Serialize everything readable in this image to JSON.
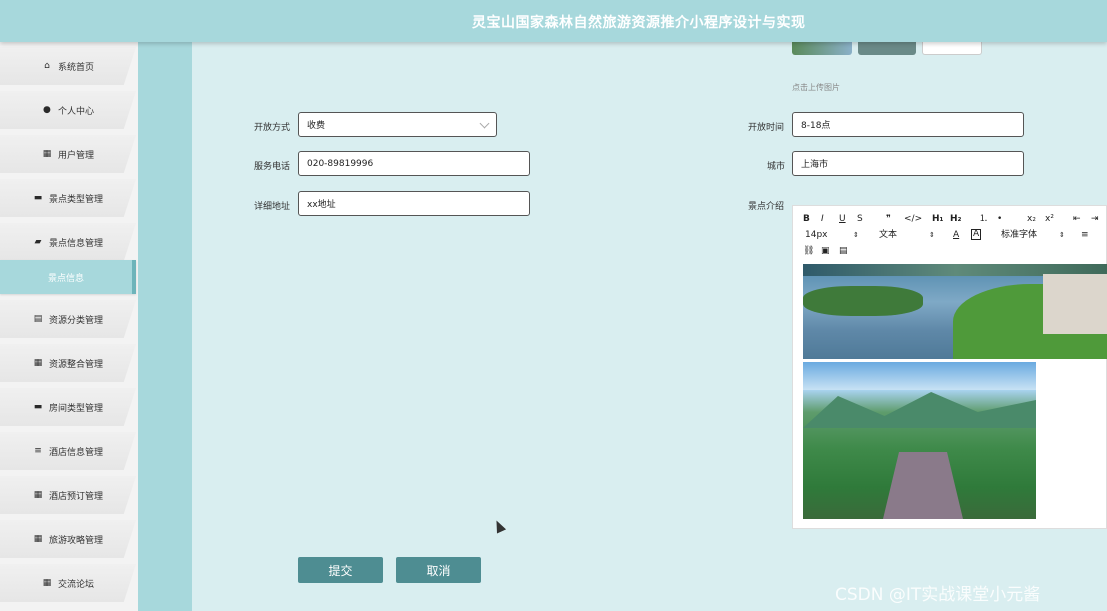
{
  "header": {
    "title": "灵宝山国家森林自然旅游资源推介小程序设计与实现"
  },
  "sidebar": {
    "items": [
      {
        "label": "系统首页",
        "icon": "home-icon",
        "glyph": "⌂",
        "active": false
      },
      {
        "label": "个人中心",
        "icon": "user-icon",
        "glyph": "●",
        "active": false
      },
      {
        "label": "用户管理",
        "icon": "grid-icon",
        "glyph": "▦",
        "active": false
      },
      {
        "label": "景点类型管理",
        "icon": "monitor-icon",
        "glyph": "▬",
        "active": false
      },
      {
        "label": "景点信息管理",
        "icon": "briefcase-icon",
        "glyph": "▰",
        "active": false
      },
      {
        "label": "景点信息",
        "icon": "",
        "glyph": "",
        "active": true
      },
      {
        "label": "资源分类管理",
        "icon": "clipboard-icon",
        "glyph": "▤",
        "active": false
      },
      {
        "label": "资源整合管理",
        "icon": "grid-icon",
        "glyph": "▦",
        "active": false
      },
      {
        "label": "房间类型管理",
        "icon": "monitor-icon",
        "glyph": "▬",
        "active": false
      },
      {
        "label": "酒店信息管理",
        "icon": "list-icon",
        "glyph": "≡",
        "active": false
      },
      {
        "label": "酒店预订管理",
        "icon": "grid-icon",
        "glyph": "▦",
        "active": false
      },
      {
        "label": "旅游攻略管理",
        "icon": "grid-icon",
        "glyph": "▦",
        "active": false
      },
      {
        "label": "交流论坛",
        "icon": "grid-icon",
        "glyph": "▦",
        "active": false
      }
    ]
  },
  "form": {
    "upload_hint": "点击上传图片",
    "open_mode": {
      "label": "开放方式",
      "value": "收费"
    },
    "open_time": {
      "label": "开放时间",
      "value": "8-18点"
    },
    "phone": {
      "label": "服务电话",
      "value": "020-89819996"
    },
    "city": {
      "label": "城市",
      "value": "上海市"
    },
    "address": {
      "label": "详细地址",
      "value": "xx地址"
    },
    "intro": {
      "label": "景点介绍"
    }
  },
  "editor": {
    "toolbar_row1": [
      "B",
      "I",
      "U",
      "S",
      "❞",
      "</>",
      "H₁",
      "H₂",
      "⒈",
      "•",
      "x₂",
      "x²",
      "⇤",
      "⇥"
    ],
    "font_size": "14px",
    "text_type": "文本",
    "font_family": "标准字体"
  },
  "buttons": {
    "submit": "提交",
    "cancel": "取消"
  },
  "watermark": "CSDN @IT实战课堂小元酱",
  "colors": {
    "header": "#a7d8dc",
    "button": "#4e8d92",
    "background": "#d9eef0"
  }
}
